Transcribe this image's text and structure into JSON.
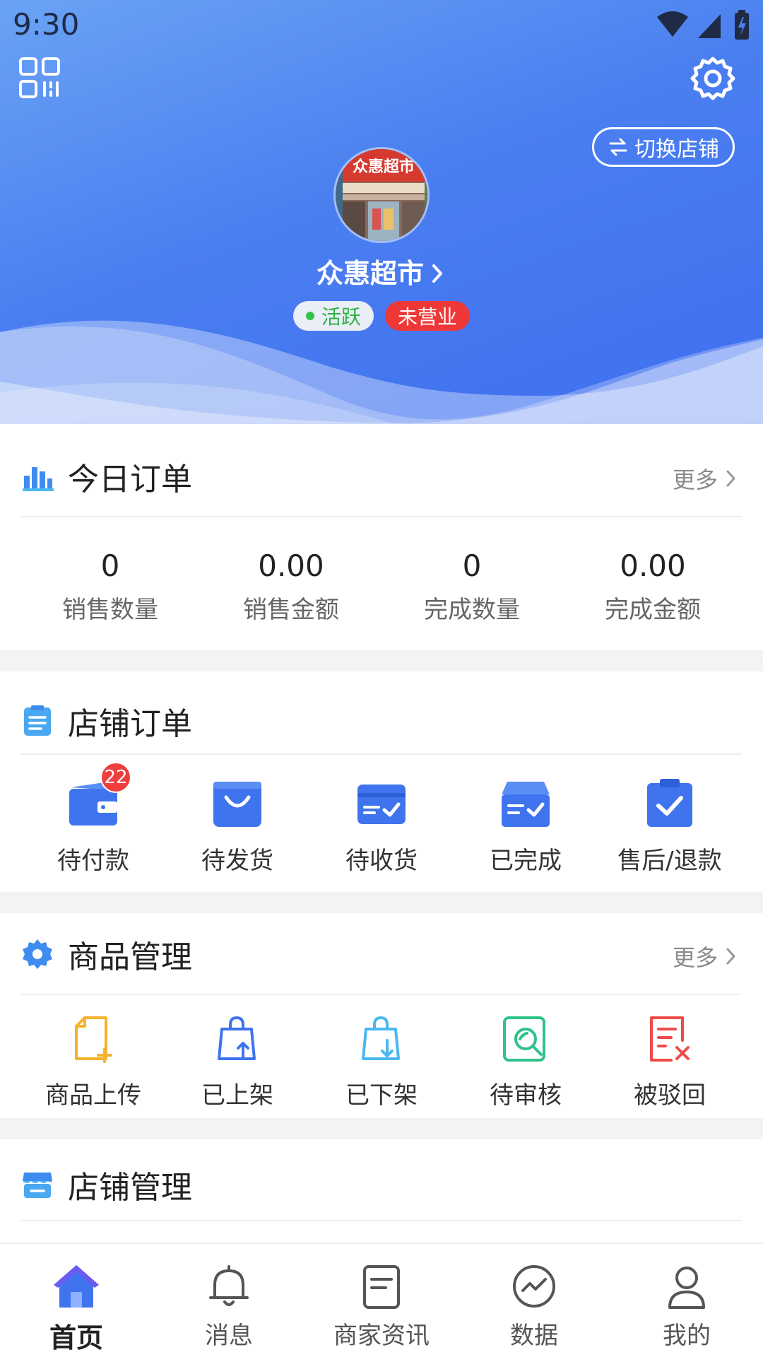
{
  "status_bar": {
    "time": "9:30"
  },
  "header": {
    "switch_store_label": "切换店铺",
    "store_name": "众惠超市",
    "avatar_sign_text": "众惠超市",
    "tags": {
      "active": "活跃",
      "closed": "未营业"
    }
  },
  "today_orders": {
    "title": "今日订单",
    "more": "更多",
    "stats": [
      {
        "value": "0",
        "label": "销售数量"
      },
      {
        "value": "0.00",
        "label": "销售金额"
      },
      {
        "value": "0",
        "label": "完成数量"
      },
      {
        "value": "0.00",
        "label": "完成金额"
      }
    ]
  },
  "store_orders": {
    "title": "店铺订单",
    "items": [
      {
        "label": "待付款",
        "icon": "wallet-icon",
        "badge": "22"
      },
      {
        "label": "待发货",
        "icon": "shopping-bag-icon"
      },
      {
        "label": "待收货",
        "icon": "card-check-icon"
      },
      {
        "label": "已完成",
        "icon": "box-check-icon"
      },
      {
        "label": "售后/退款",
        "icon": "clipboard-check-icon"
      }
    ]
  },
  "goods_management": {
    "title": "商品管理",
    "more": "更多",
    "items": [
      {
        "label": "商品上传",
        "icon": "file-add-icon"
      },
      {
        "label": "已上架",
        "icon": "bag-up-icon"
      },
      {
        "label": "已下架",
        "icon": "bag-down-icon"
      },
      {
        "label": "待审核",
        "icon": "review-search-icon"
      },
      {
        "label": "被驳回",
        "icon": "rejected-doc-icon"
      }
    ]
  },
  "store_management": {
    "title": "店铺管理"
  },
  "tabbar": [
    {
      "label": "首页",
      "icon": "home-icon",
      "active": true
    },
    {
      "label": "消息",
      "icon": "bell-icon"
    },
    {
      "label": "商家资讯",
      "icon": "news-doc-icon"
    },
    {
      "label": "数据",
      "icon": "chart-circle-icon"
    },
    {
      "label": "我的",
      "icon": "user-icon"
    }
  ],
  "colors": {
    "primary": "#4a7ff0",
    "badge": "#ef3e3e",
    "active_tag": "#31b043",
    "closed_tag": "#ee3737",
    "orange": "#f5b22c",
    "green": "#2fc28a",
    "red": "#ef4a4a",
    "cyan": "#49b8f0"
  }
}
